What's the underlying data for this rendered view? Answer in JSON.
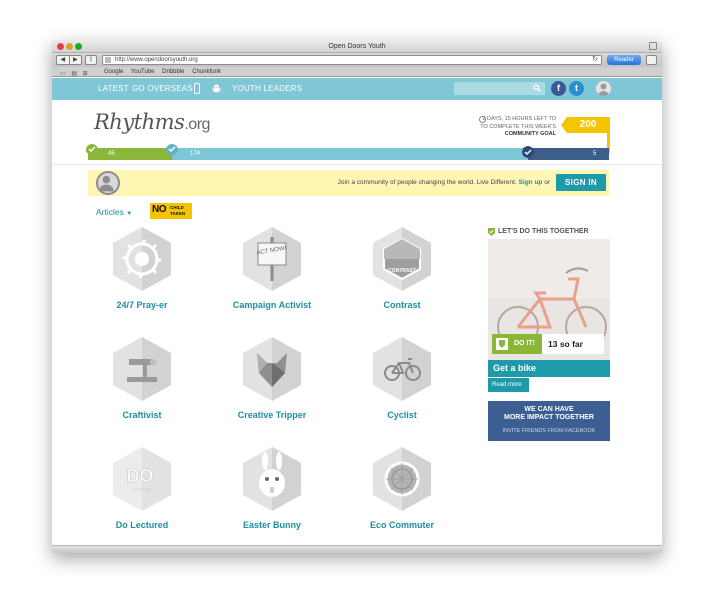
{
  "window": {
    "title": "Open Doors Youth"
  },
  "browser": {
    "url": "http://www.opendoorsyouth.org",
    "reader_label": "Reader",
    "bookmarks": [
      "Google",
      "YouTube",
      "Dribbble",
      "Chunkfunk"
    ]
  },
  "nav": {
    "latest": "LATEST",
    "go_overseas": "GO OVERSEAS",
    "youth_leaders": "YOUTH LEADERS",
    "search_placeholder": ""
  },
  "header": {
    "logo_main": "Rhythms",
    "logo_suffix": ".org",
    "goal_line1": "2 DAYS, 15 HOURS LEFT TO",
    "goal_line2": "TO COMPLETE THIS WEEK'S",
    "goal_line3": "COMMUNITY GOAL",
    "goal_number": "200"
  },
  "progress": {
    "green_label": "45",
    "blue_label": "174",
    "dark_label": "5",
    "green_value": 45,
    "blue_value": 174,
    "dark_value": 5,
    "goal": 200
  },
  "join": {
    "text": "Join a community of people changing the world. Live Different.",
    "signup": "Sign up",
    "or": "or",
    "signin": "SIGN IN"
  },
  "articles": {
    "label": "Articles",
    "caret": "▼",
    "nochild_no": "NO",
    "nochild_small": "CHILD TAKEN"
  },
  "badges": [
    {
      "label": "24/7 Pray-er",
      "icon": "prayer-icon"
    },
    {
      "label": "Campaign Activist",
      "icon": "act-now-sign-icon",
      "sign_text": "ACT NOW!"
    },
    {
      "label": "Contrast",
      "icon": "contrast-icon",
      "sign_text": "CONTRAST"
    },
    {
      "label": "Craftivist",
      "icon": "sewing-machine-icon"
    },
    {
      "label": "Creative Tripper",
      "icon": "origami-fox-icon"
    },
    {
      "label": "Cyclist",
      "icon": "bicycle-icon"
    },
    {
      "label": "Do Lectured",
      "icon": "do-lectures-icon",
      "sign_text": "DO",
      "sign_sub": "lectures"
    },
    {
      "label": "Easter Bunny",
      "icon": "bunny-icon"
    },
    {
      "label": "Eco Commuter",
      "icon": "wheel-icon"
    }
  ],
  "sidebar": {
    "heading": "LET'S DO THIS TOGETHER",
    "do_it": "DO IT!",
    "so_far": "13 so far",
    "get_bike": "Get a bike",
    "read_more": "Read more",
    "fb_line1": "WE CAN HAVE",
    "fb_line2": "MORE IMPACT TOGETHER",
    "fb_line3": "INVITE FRIENDS FROM FACEBOOK"
  },
  "colors": {
    "teal": "#1e9aab",
    "nav_blue": "#7fc7d6",
    "green": "#8cb63a",
    "yellow": "#f5c400",
    "join_yellow": "#fff6b3",
    "facebook_blue": "#3d5e93"
  }
}
